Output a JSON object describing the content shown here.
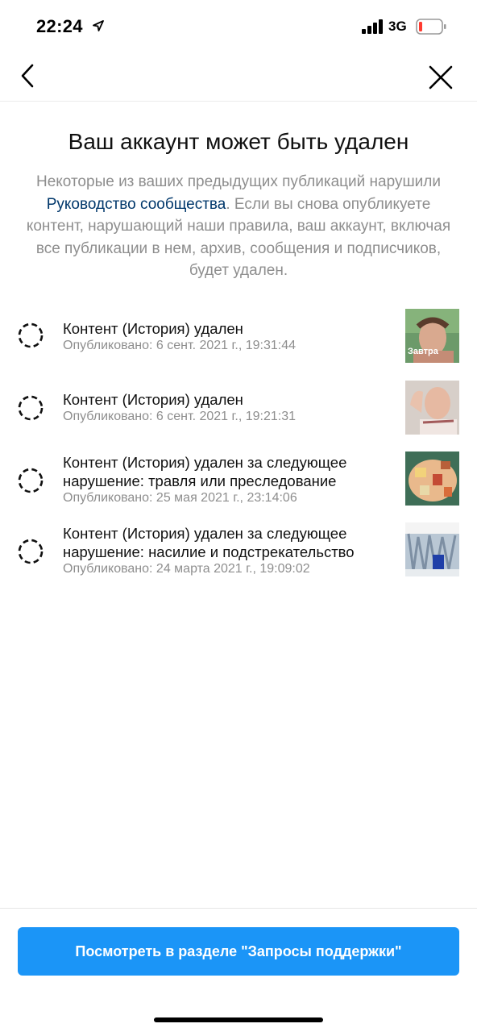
{
  "status_bar": {
    "time": "22:24",
    "network": "3G",
    "icons": [
      "location-arrow-icon",
      "signal-icon",
      "battery-icon"
    ],
    "battery_level": 0.1,
    "battery_color": "#ff3b30"
  },
  "nav": {
    "back_icon": "chevron-left-icon",
    "close_icon": "close-icon"
  },
  "header": {
    "title": "Ваш аккаунт может быть удален",
    "description_before": "Некоторые из ваших предыдущих публикаций нарушили ",
    "description_link": "Руководство сообщества",
    "description_after": ". Если вы снова опубликуете контент, нарушающий наши правила, ваш аккаунт, включая все публикации в нем, архив, сообщения и подписчиков, будет удален."
  },
  "items": [
    {
      "title": "Контент (История) удален",
      "date": "Опубликовано: 6 сент. 2021 г., 19:31:44",
      "thumb_text": "Завтра"
    },
    {
      "title": "Контент (История) удален",
      "date": "Опубликовано: 6 сент. 2021 г., 19:21:31"
    },
    {
      "title": "Контент (История) удален за следующее нарушение: травля или преследование",
      "date": "Опубликовано: 25 мая 2021 г., 23:14:06"
    },
    {
      "title": "Контент (История) удален за следующее нарушение: насилие и подстрекательство",
      "date": "Опубликовано: 24 марта 2021 г., 19:09:02"
    }
  ],
  "footer": {
    "button_label": "Посмотреть в разделе \"Запросы поддержки\""
  },
  "colors": {
    "accent": "#1b95f7",
    "link": "#00376b",
    "secondary_text": "#8e8e8e"
  }
}
